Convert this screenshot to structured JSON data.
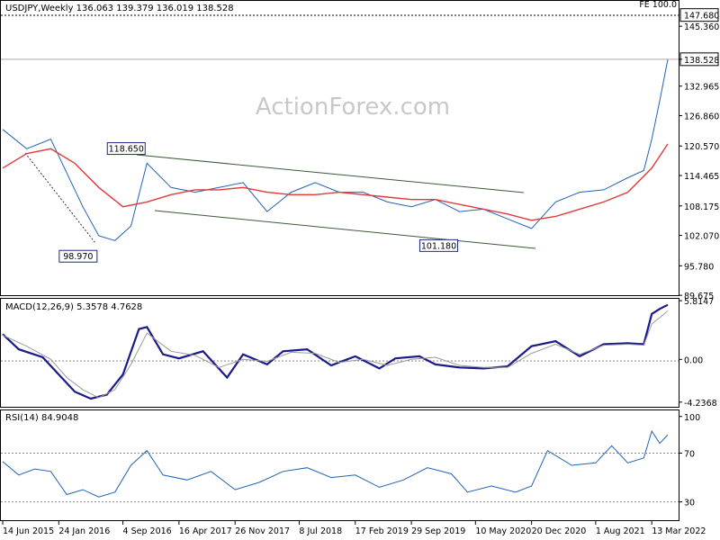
{
  "chart_data": [
    {
      "panel": "price",
      "type": "line",
      "title": "USDJPY,Weekly  136.063 139.379 136.019 138.528",
      "watermark": "ActionForex.com",
      "top_right_label": "FE 100.0",
      "last_price_label": "138.528",
      "level_label": "147.680",
      "y_ticks": [
        "145.360",
        "138.528",
        "132.965",
        "126.860",
        "120.570",
        "114.465",
        "108.175",
        "102.070",
        "95.780",
        "89.675"
      ],
      "ylim": [
        89.7,
        150.6
      ],
      "x_ticks": [
        "14 Jun 2015",
        "24 Jan 2016",
        "4 Sep 2016",
        "16 Apr 2017",
        "26 Nov 2017",
        "8 Jul 2018",
        "17 Feb 2019",
        "29 Sep 2019",
        "10 May 2020",
        "20 Dec 2020",
        "1 Aug 2021",
        "13 Mar 2022"
      ],
      "annotations": [
        {
          "text": "118.650",
          "value": 118.65,
          "date": "2016-12"
        },
        {
          "text": "98.970",
          "value": 98.97,
          "date": "2016-06"
        },
        {
          "text": "101.180",
          "value": 101.18,
          "date": "2020-03"
        }
      ],
      "series": [
        {
          "color": "#1f63b5",
          "x": [
            "2015-06",
            "2015-09",
            "2015-12",
            "2016-02",
            "2016-04",
            "2016-06",
            "2016-08",
            "2016-10",
            "2016-12",
            "2017-03",
            "2017-06",
            "2017-09",
            "2017-12",
            "2018-03",
            "2018-06",
            "2018-09",
            "2018-12",
            "2019-03",
            "2019-06",
            "2019-09",
            "2019-12",
            "2020-03",
            "2020-06",
            "2020-09",
            "2020-12",
            "2021-03",
            "2021-06",
            "2021-09",
            "2021-12",
            "2022-02",
            "2022-03",
            "2022-04",
            "2022-05"
          ],
          "values": [
            124,
            120,
            122,
            115,
            108,
            102,
            101,
            104,
            117,
            112,
            111,
            112,
            113,
            107,
            111,
            113,
            111,
            111,
            109,
            108,
            109.5,
            107,
            107.5,
            105.5,
            103.5,
            109,
            111,
            111.5,
            114,
            115.5,
            122,
            130,
            138.5
          ]
        },
        {
          "color": "#e03a3a",
          "x": [
            "2015-06",
            "2015-09",
            "2015-12",
            "2016-03",
            "2016-06",
            "2016-09",
            "2016-12",
            "2017-03",
            "2017-06",
            "2017-09",
            "2017-12",
            "2018-03",
            "2018-06",
            "2018-09",
            "2018-12",
            "2019-03",
            "2019-06",
            "2019-09",
            "2019-12",
            "2020-03",
            "2020-06",
            "2020-09",
            "2020-12",
            "2021-03",
            "2021-06",
            "2021-09",
            "2021-12",
            "2022-03",
            "2022-05"
          ],
          "values": [
            116,
            119,
            120,
            117,
            112,
            108,
            109,
            110.5,
            111.5,
            111.5,
            112,
            111,
            110.5,
            110.5,
            111,
            110.5,
            110,
            109.5,
            109.5,
            108.5,
            107.5,
            106.5,
            105.2,
            106,
            107.5,
            109,
            111,
            116,
            121
          ]
        }
      ]
    },
    {
      "panel": "macd",
      "type": "line",
      "title": "MACD(12,26,9) 5.3578 4.7628",
      "y_ticks": [
        "5.8147",
        "0.00",
        "-4.2368"
      ],
      "ylim": [
        -4.7,
        6.0
      ],
      "series": [
        {
          "color": "#1a1a8a",
          "x": [
            "2015-06",
            "2015-08",
            "2015-11",
            "2016-01",
            "2016-03",
            "2016-05",
            "2016-07",
            "2016-09",
            "2016-11",
            "2016-12",
            "2017-02",
            "2017-04",
            "2017-07",
            "2017-10",
            "2017-12",
            "2018-03",
            "2018-05",
            "2018-08",
            "2018-11",
            "2019-02",
            "2019-05",
            "2019-07",
            "2019-10",
            "2019-12",
            "2020-03",
            "2020-06",
            "2020-09",
            "2020-12",
            "2021-03",
            "2021-06",
            "2021-09",
            "2021-12",
            "2022-02",
            "2022-03",
            "2022-04",
            "2022-05"
          ],
          "values": [
            2.5,
            1.0,
            0.2,
            -1.5,
            -3.2,
            -3.9,
            -3.5,
            -1.5,
            3.0,
            3.2,
            0.5,
            0.1,
            0.8,
            -1.8,
            0.5,
            -0.5,
            0.8,
            1.0,
            -0.6,
            0.3,
            -0.9,
            0.1,
            0.3,
            -0.5,
            -0.8,
            -0.9,
            -0.7,
            1.3,
            1.8,
            0.3,
            1.5,
            1.6,
            1.5,
            4.5,
            5.0,
            5.4
          ]
        },
        {
          "color": "#9a9a9a",
          "x": [
            "2015-06",
            "2015-09",
            "2015-12",
            "2016-02",
            "2016-04",
            "2016-06",
            "2016-08",
            "2016-10",
            "2016-12",
            "2017-03",
            "2017-06",
            "2017-09",
            "2017-12",
            "2018-03",
            "2018-06",
            "2018-09",
            "2018-12",
            "2019-03",
            "2019-06",
            "2019-09",
            "2019-12",
            "2020-03",
            "2020-06",
            "2020-09",
            "2020-12",
            "2021-03",
            "2021-06",
            "2021-09",
            "2021-12",
            "2022-02",
            "2022-03",
            "2022-05"
          ],
          "values": [
            2.4,
            1.3,
            0.0,
            -1.8,
            -3.0,
            -3.8,
            -3.0,
            -0.5,
            2.6,
            0.8,
            0.4,
            -0.8,
            0.0,
            -0.2,
            0.7,
            0.6,
            -0.3,
            0.0,
            -0.6,
            0.0,
            0.2,
            -0.6,
            -0.8,
            -0.8,
            0.6,
            1.5,
            0.5,
            1.4,
            1.5,
            1.4,
            3.5,
            4.8
          ]
        }
      ]
    },
    {
      "panel": "rsi",
      "type": "line",
      "title": "RSI(14) 84.9048",
      "y_ticks": [
        "100",
        "70",
        "30"
      ],
      "levels": [
        70,
        30
      ],
      "ylim": [
        15,
        105
      ],
      "series": [
        {
          "color": "#1f63b5",
          "x": [
            "2015-06",
            "2015-08",
            "2015-10",
            "2015-12",
            "2016-02",
            "2016-04",
            "2016-06",
            "2016-08",
            "2016-10",
            "2016-12",
            "2017-02",
            "2017-05",
            "2017-08",
            "2017-11",
            "2018-02",
            "2018-05",
            "2018-08",
            "2018-11",
            "2019-02",
            "2019-05",
            "2019-08",
            "2019-11",
            "2020-02",
            "2020-04",
            "2020-07",
            "2020-10",
            "2020-12",
            "2021-02",
            "2021-05",
            "2021-08",
            "2021-10",
            "2021-12",
            "2022-02",
            "2022-03",
            "2022-04",
            "2022-05"
          ],
          "values": [
            63,
            52,
            57,
            55,
            36,
            40,
            34,
            38,
            60,
            72,
            52,
            48,
            55,
            40,
            46,
            55,
            58,
            50,
            52,
            42,
            48,
            58,
            53,
            38,
            43,
            38,
            43,
            72,
            60,
            62,
            76,
            62,
            66,
            88,
            78,
            85
          ]
        }
      ]
    }
  ]
}
